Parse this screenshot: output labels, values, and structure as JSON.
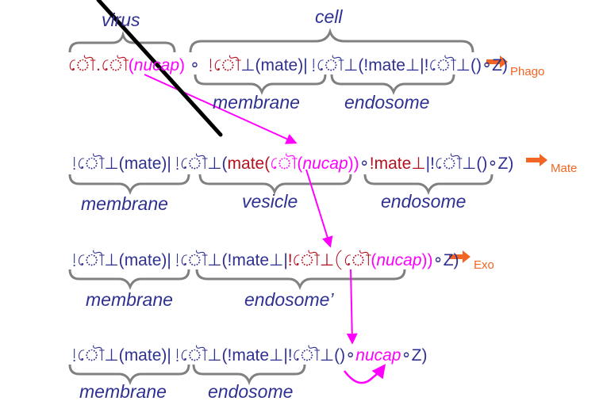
{
  "colors": {
    "process": "#2e3192",
    "focus": "#ff00ff",
    "active": "#b3121f",
    "brace": "#808080",
    "action": "#f26522",
    "strike": "#000000"
  },
  "symbols": {
    "phago": "ৌ",
    "bang": "!",
    "perp": "⊥",
    "circ": "∘",
    "lpar": "(",
    "rpar": ")",
    "dot": "."
  },
  "labels": {
    "virus": "virus",
    "cell": "cell",
    "membrane": "membrane",
    "endosome": "endosome",
    "vesicle": "vesicle",
    "endosome_prime": "endosome’"
  },
  "terms": {
    "nucap": "nucap",
    "mate": "mate",
    "Z": "Z"
  },
  "rows": [
    {
      "action": "Phago",
      "text": "ঌ.ঌ(nucap) ∘ !ঌ⊥(mate)|!ঌ⊥(!mate⊥|!ঌ⊥()∘Z)"
    },
    {
      "action": "Mate",
      "text": "!ঌ⊥(mate)|!ঌ⊥(mate(ঌ(nucap))∘!mate⊥|!ঌ⊥()∘Z)"
    },
    {
      "action": "Exo",
      "text": "!ঌ⊥(mate)|!ঌ⊥(!mate⊥|!ঌ⊥(ঌ(nucap))∘Z)"
    },
    {
      "action": "",
      "text": "!ঌ⊥(mate)|!ঌ⊥(!mate⊥|!ঌ⊥()∘nucap∘Z)"
    }
  ]
}
